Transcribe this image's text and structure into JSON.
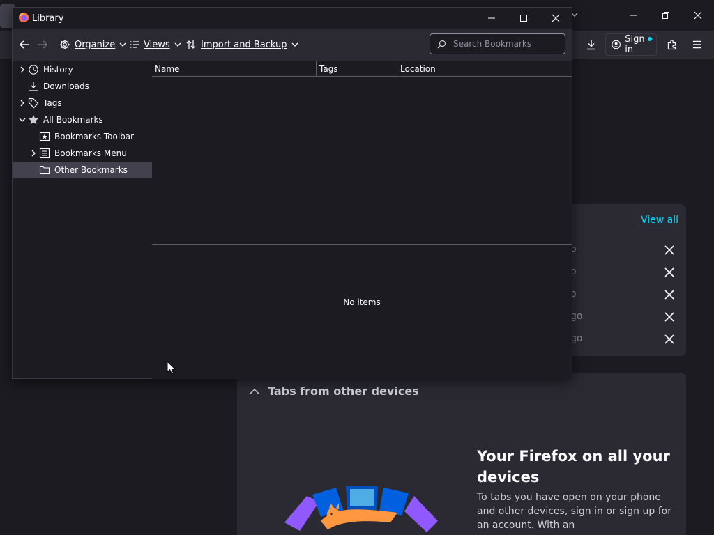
{
  "background": {
    "toolbar": {
      "signin_label": "Sign in"
    },
    "recent": {
      "view_all": "View all",
      "row_fragments": [
        "o",
        "o",
        "o",
        "go",
        "go"
      ]
    },
    "devices": {
      "heading": "Tabs from other devices",
      "title": "Your Firefox on all your devices",
      "text": "To tabs you have open on your phone and other devices, sign in or sign up for an account. With an"
    }
  },
  "library": {
    "title": "Library",
    "toolbar": {
      "organize": "Organize",
      "views": "Views",
      "import_backup": "Import and Backup"
    },
    "search": {
      "placeholder": "Search Bookmarks"
    },
    "sidebar": {
      "items": [
        {
          "label": "History",
          "icon": "clock-icon",
          "twisty": "collapsed",
          "indent": 0
        },
        {
          "label": "Downloads",
          "icon": "download-icon",
          "twisty": "none",
          "indent": 0
        },
        {
          "label": "Tags",
          "icon": "tag-icon",
          "twisty": "collapsed",
          "indent": 0
        },
        {
          "label": "All Bookmarks",
          "icon": "star-icon",
          "twisty": "expanded",
          "indent": 0
        },
        {
          "label": "Bookmarks Toolbar",
          "icon": "bookmark-toolbar-icon",
          "twisty": "none",
          "indent": 1
        },
        {
          "label": "Bookmarks Menu",
          "icon": "bookmark-menu-icon",
          "twisty": "collapsed",
          "indent": 1
        },
        {
          "label": "Other Bookmarks",
          "icon": "folder-icon",
          "twisty": "none",
          "indent": 1,
          "selected": true
        }
      ]
    },
    "columns": [
      "Name",
      "Tags",
      "Location"
    ],
    "details": {
      "empty_text": "No items"
    }
  },
  "colors": {
    "accent": "#00ddff",
    "bg": "#1c1b22",
    "toolbar": "#2b2a33",
    "selected": "#42414d"
  }
}
